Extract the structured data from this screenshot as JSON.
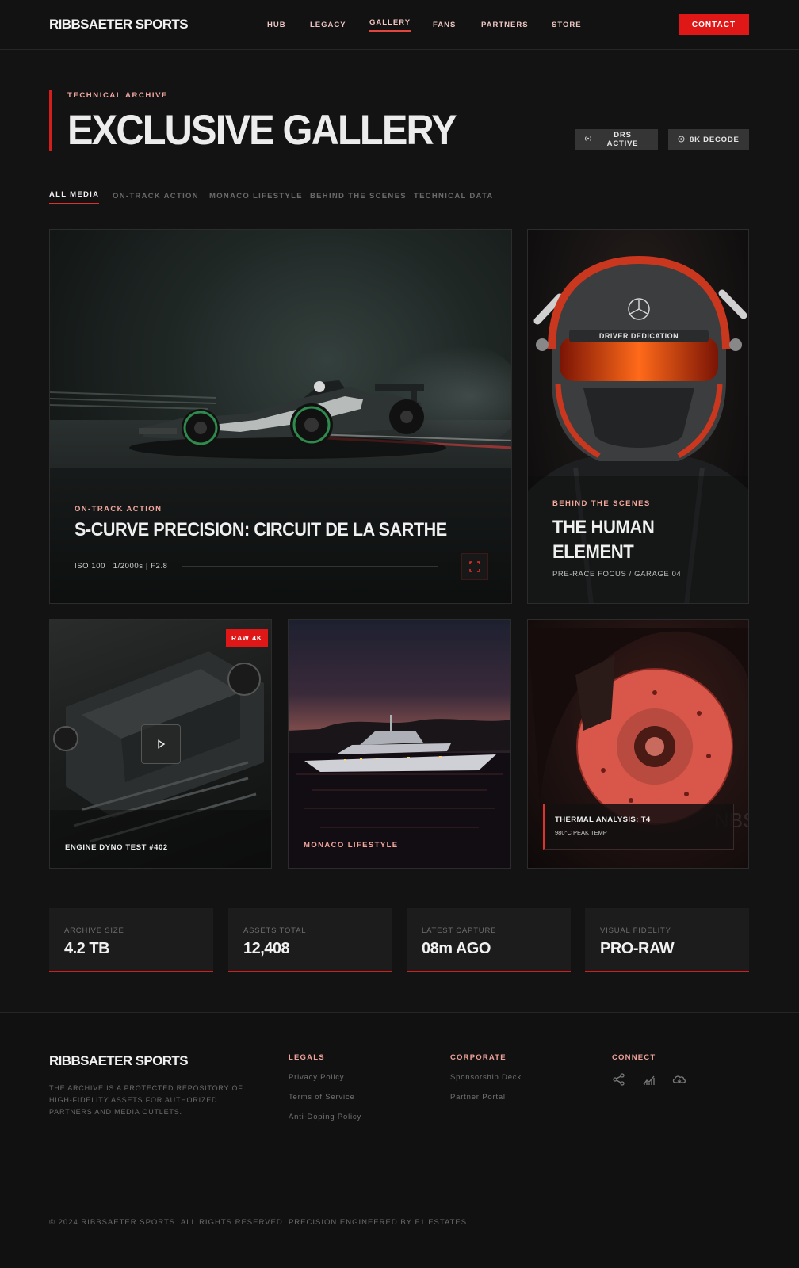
{
  "brand": "RIBBSAETER SPORTS",
  "nav": {
    "items": [
      "HUB",
      "LEGACY",
      "GALLERY",
      "FANS",
      "PARTNERS",
      "STORE"
    ],
    "active": "GALLERY",
    "contact": "CONTACT"
  },
  "hero": {
    "eyebrow": "TECHNICAL ARCHIVE",
    "title": "EXCLUSIVE GALLERY",
    "pills": [
      {
        "icon": "radio-icon",
        "label": "DRS ACTIVE"
      },
      {
        "icon": "target-icon",
        "label": "8K DECODE"
      }
    ]
  },
  "filters": [
    "ALL MEDIA",
    "ON-TRACK ACTION",
    "MONACO LIFESTYLE",
    "BEHIND THE SCENES",
    "TECHNICAL DATA"
  ],
  "cards": {
    "featured": {
      "label": "ON-TRACK ACTION",
      "title": "S-CURVE PRECISION: CIRCUIT DE LA SARTHE",
      "meta": "ISO 100 | 1/2000s | F2.8"
    },
    "helmet": {
      "label": "BEHIND THE SCENES",
      "title_line1": "THE HUMAN",
      "title_line2": "ELEMENT",
      "meta": "PRE-RACE FOCUS / GARAGE 04",
      "visor_text": "DRIVER DEDICATION"
    },
    "engine": {
      "badge": "RAW 4K",
      "caption": "ENGINE DYNO TEST #402"
    },
    "yacht": {
      "caption": "MONACO LIFESTYLE"
    },
    "brake": {
      "title": "THERMAL ANALYSIS: T4",
      "sub": "980°C PEAK TEMP"
    }
  },
  "stats": [
    {
      "label": "ARCHIVE SIZE",
      "value": "4.2 TB"
    },
    {
      "label": "ASSETS TOTAL",
      "value": "12,408"
    },
    {
      "label": "LATEST CAPTURE",
      "value": "08m AGO"
    },
    {
      "label": "VISUAL FIDELITY",
      "value": "PRO-RAW"
    }
  ],
  "footer": {
    "brand": "RIBBSAETER SPORTS",
    "description": "THE ARCHIVE IS A PROTECTED REPOSITORY OF HIGH-FIDELITY ASSETS FOR AUTHORIZED PARTNERS AND MEDIA OUTLETS.",
    "legals": {
      "heading": "LEGALS",
      "links": [
        "Privacy Policy",
        "Terms of Service",
        "Anti-Doping Policy"
      ]
    },
    "corporate": {
      "heading": "CORPORATE",
      "links": [
        "Sponsorship Deck",
        "Partner Portal"
      ]
    },
    "connect": {
      "heading": "CONNECT",
      "icons": [
        "share-icon",
        "analytics-icon",
        "cloud-download-icon"
      ]
    },
    "copyright": "© 2024 RIBBSAETER SPORTS. ALL RIGHTS RESERVED. PRECISION ENGINEERED BY F1 ESTATES."
  },
  "colors": {
    "accent": "#e01717",
    "accent_text": "#f1a79f",
    "background": "#131313"
  }
}
